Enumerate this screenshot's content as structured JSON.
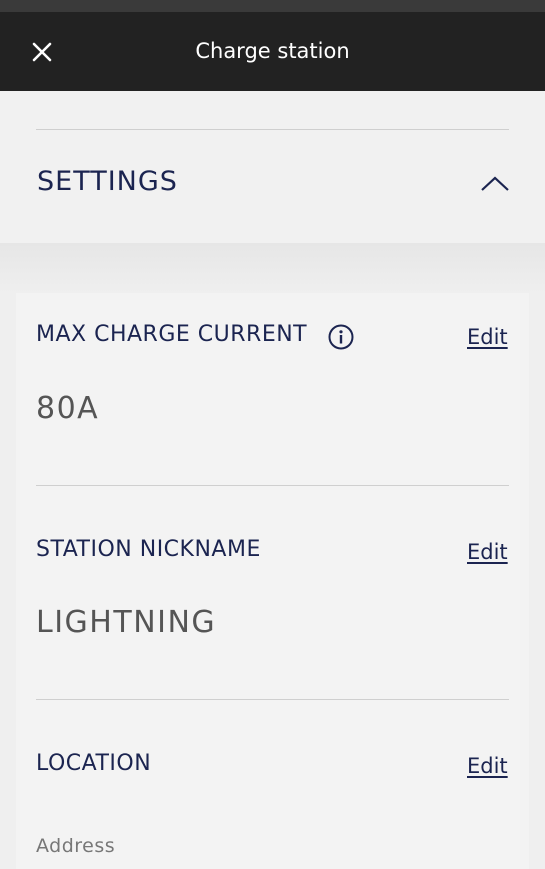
{
  "header": {
    "title": "Charge station",
    "close_icon": "close-icon"
  },
  "settings": {
    "title": "SETTINGS",
    "toggle_icon": "chevron-up-icon",
    "expanded": true
  },
  "fields": {
    "max_charge_current": {
      "label": "MAX CHARGE CURRENT",
      "value": "80A",
      "edit_label": "Edit",
      "info_icon": "info-icon"
    },
    "station_nickname": {
      "label": "STATION NICKNAME",
      "value": "LIGHTNING",
      "edit_label": "Edit"
    },
    "location": {
      "label": "LOCATION",
      "edit_label": "Edit",
      "address_label": "Address"
    }
  },
  "colors": {
    "header_bg": "#222222",
    "accent_text": "#1b2450",
    "value_text": "#555555",
    "page_bg": "#efefef"
  }
}
